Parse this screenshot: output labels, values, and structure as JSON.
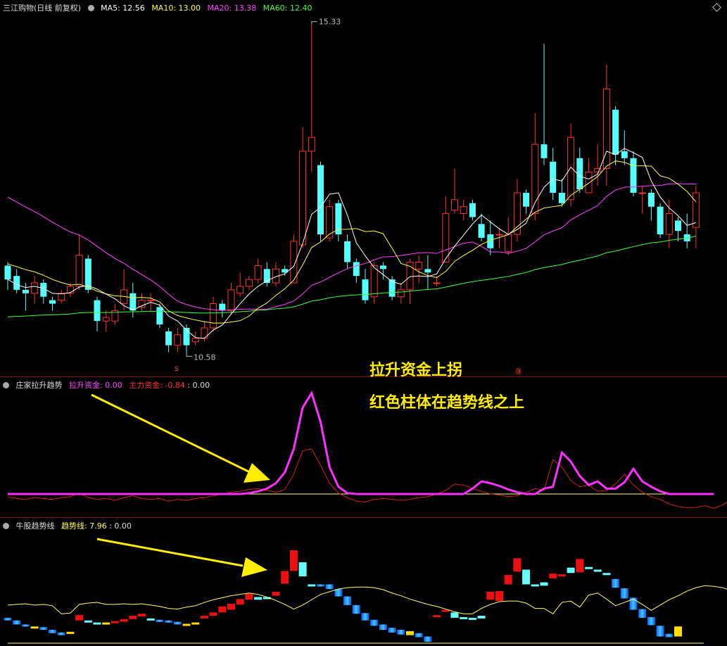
{
  "main": {
    "title": "三江购物(日线 前复权)",
    "ma5": "MA5: 12.56",
    "ma10": "MA10: 13.00",
    "ma20": "MA20: 13.38",
    "ma60": "MA60: 12.40",
    "high_label": "15.33",
    "low_label": "10.58",
    "low_marker": "S",
    "rise_marker": "涨"
  },
  "annotations": {
    "line1": "拉升资金上拐",
    "line2": "红色柱体在趋势线之上"
  },
  "ind1": {
    "name": "庄家拉升趋势",
    "s1": "拉升资金: 0.00",
    "s2": "主力资金: -0.84",
    "s3": ": 0.00"
  },
  "ind2": {
    "name": "牛股趋势线",
    "s1": "趋势线: 7.96",
    "s2": ": 0.00"
  },
  "colors": {
    "up": "#ff3030",
    "down": "#54ffff",
    "ma5": "#ffffff",
    "ma10": "#ffff40",
    "ma20": "#ff40ff",
    "ma60": "#40ff40",
    "annotation": "#ffee00"
  },
  "chart_data": [
    {
      "type": "candlestick",
      "ylim": [
        10.3,
        15.5
      ],
      "candles": [
        [
          11.85,
          11.65,
          11.9,
          11.5
        ],
        [
          11.7,
          11.5,
          11.8,
          11.45
        ],
        [
          11.5,
          11.45,
          11.6,
          11.2
        ],
        [
          11.45,
          11.6,
          11.7,
          11.3
        ],
        [
          11.6,
          11.4,
          11.65,
          11.3
        ],
        [
          11.35,
          11.3,
          11.4,
          11.2
        ],
        [
          11.35,
          11.45,
          11.5,
          11.3
        ],
        [
          11.45,
          11.55,
          11.6,
          11.4
        ],
        [
          11.55,
          12.0,
          12.3,
          11.5
        ],
        [
          11.95,
          11.5,
          12.0,
          11.45
        ],
        [
          11.35,
          11.05,
          11.4,
          10.9
        ],
        [
          11.05,
          11.1,
          11.2,
          10.9
        ],
        [
          11.05,
          11.2,
          11.3,
          11.0
        ],
        [
          11.3,
          11.5,
          11.8,
          11.2
        ],
        [
          11.45,
          11.2,
          11.6,
          11.1
        ],
        [
          11.25,
          11.35,
          11.45,
          11.2
        ],
        [
          11.35,
          11.35,
          11.45,
          11.2
        ],
        [
          11.25,
          11.0,
          11.3,
          10.95
        ],
        [
          10.9,
          10.7,
          10.95,
          10.6
        ],
        [
          10.7,
          10.85,
          10.95,
          10.6
        ],
        [
          10.95,
          10.7,
          11.0,
          10.58
        ],
        [
          10.75,
          10.8,
          10.9,
          10.7
        ],
        [
          10.8,
          10.95,
          11.05,
          10.75
        ],
        [
          10.95,
          11.3,
          11.4,
          10.9
        ],
        [
          11.3,
          11.2,
          11.35,
          11.1
        ],
        [
          11.2,
          11.5,
          11.6,
          11.15
        ],
        [
          11.45,
          11.55,
          11.75,
          11.4
        ],
        [
          11.55,
          11.65,
          11.7,
          11.5
        ],
        [
          11.65,
          11.85,
          11.95,
          11.6
        ],
        [
          11.8,
          11.6,
          11.9,
          11.55
        ],
        [
          11.6,
          11.8,
          11.9,
          11.55
        ],
        [
          11.8,
          11.75,
          11.85,
          11.7
        ],
        [
          11.6,
          12.2,
          12.3,
          11.6
        ],
        [
          12.15,
          13.5,
          13.85,
          12.1
        ],
        [
          13.5,
          13.7,
          15.33,
          13.2
        ],
        [
          13.3,
          12.3,
          13.35,
          12.2
        ],
        [
          12.25,
          12.7,
          12.8,
          12.2
        ],
        [
          12.75,
          12.3,
          12.8,
          12.2
        ],
        [
          12.2,
          11.9,
          12.3,
          11.8
        ],
        [
          11.9,
          11.7,
          11.95,
          11.6
        ],
        [
          11.65,
          11.35,
          11.8,
          11.3
        ],
        [
          11.4,
          11.85,
          11.9,
          11.3
        ],
        [
          11.85,
          11.8,
          11.9,
          11.65
        ],
        [
          11.65,
          11.4,
          11.7,
          11.35
        ],
        [
          11.4,
          11.5,
          11.6,
          11.3
        ],
        [
          11.5,
          11.9,
          11.95,
          11.3
        ],
        [
          11.8,
          11.9,
          12.0,
          11.6
        ],
        [
          11.8,
          11.75,
          12.0,
          11.5
        ],
        [
          11.6,
          11.6,
          11.7,
          11.55
        ],
        [
          11.9,
          12.6,
          12.85,
          11.9
        ],
        [
          12.65,
          12.8,
          13.25,
          12.6
        ],
        [
          12.6,
          12.7,
          12.8,
          12.5
        ],
        [
          12.75,
          12.55,
          12.8,
          12.5
        ],
        [
          12.45,
          12.25,
          12.6,
          12.2
        ],
        [
          12.3,
          12.1,
          12.5,
          12.0
        ],
        [
          12.3,
          12.3,
          12.4,
          12.1
        ],
        [
          12.05,
          12.3,
          12.55,
          12.0
        ],
        [
          12.3,
          12.9,
          13.1,
          12.2
        ],
        [
          12.9,
          12.7,
          12.95,
          12.6
        ],
        [
          12.6,
          13.6,
          14.05,
          12.5
        ],
        [
          13.6,
          13.4,
          15.05,
          13.3
        ],
        [
          13.35,
          12.9,
          13.55,
          12.8
        ],
        [
          12.9,
          12.75,
          13.1,
          12.7
        ],
        [
          12.8,
          13.7,
          13.9,
          12.7
        ],
        [
          13.4,
          12.95,
          13.55,
          12.9
        ],
        [
          12.9,
          13.2,
          13.4,
          12.9
        ],
        [
          13.2,
          13.25,
          13.6,
          13.0
        ],
        [
          13.25,
          14.4,
          14.75,
          13.0
        ],
        [
          14.1,
          13.45,
          14.15,
          13.3
        ],
        [
          13.5,
          13.4,
          13.8,
          13.3
        ],
        [
          13.4,
          12.9,
          13.5,
          12.85
        ],
        [
          12.9,
          12.9,
          13.0,
          12.6
        ],
        [
          12.9,
          12.7,
          12.95,
          12.5
        ],
        [
          12.7,
          12.3,
          12.75,
          12.25
        ],
        [
          12.3,
          12.6,
          12.8,
          12.1
        ],
        [
          12.5,
          12.35,
          12.55,
          12.2
        ],
        [
          12.3,
          12.2,
          12.6,
          12.1
        ],
        [
          12.4,
          12.9,
          13.0,
          12.1
        ]
      ],
      "ma_lines": [
        "MA5",
        "MA10",
        "MA20",
        "MA60"
      ]
    },
    {
      "type": "line",
      "series": [
        {
          "name": "拉升资金",
          "values": [
            0,
            0,
            0,
            0,
            0,
            0,
            0,
            0,
            0,
            0,
            0,
            0,
            0,
            0,
            0,
            0,
            0,
            0,
            0,
            0,
            0,
            0,
            0,
            0,
            0,
            0,
            0,
            0.1,
            0.3,
            0.6,
            1.2,
            2.4,
            5,
            9.6,
            11.2,
            8,
            3,
            0.8,
            0.1,
            0,
            0,
            0,
            0,
            0,
            0,
            0,
            0,
            0,
            0,
            0,
            0,
            0,
            0.6,
            1.4,
            1.2,
            0.9,
            0.5,
            0.2,
            0,
            0,
            0.6,
            0.8,
            4.6,
            3.6,
            2,
            1,
            1.4,
            0.6,
            0.6,
            1.3,
            2.8,
            1.4,
            0.8,
            0.3,
            0,
            0,
            0,
            0,
            0,
            0
          ]
        },
        {
          "name": "主力资金",
          "values": [
            -0.3,
            -0.5,
            -0.6,
            -0.4,
            -0.5,
            -0.6,
            -0.4,
            -0.3,
            0.1,
            -0.4,
            -0.6,
            -0.5,
            -0.7,
            -0.4,
            -0.2,
            -0.5,
            -0.6,
            -0.5,
            -0.8,
            -0.6,
            -0.7,
            -0.5,
            -0.4,
            -0.2,
            0,
            0.2,
            0.3,
            0.5,
            0.6,
            0.4,
            0.2,
            0.5,
            2.2,
            4.8,
            5,
            3.2,
            1.2,
            0.1,
            -0.4,
            -0.8,
            -0.9,
            -0.6,
            -0.5,
            -0.6,
            -0.7,
            -0.6,
            -0.4,
            -0.3,
            0,
            0.4,
            1.1,
            1,
            0.6,
            0.3,
            0,
            -0.1,
            -0.3,
            -0.2,
            0.2,
            0.6,
            0.4,
            3.8,
            3,
            1.5,
            0.8,
            1,
            0.3,
            0.4,
            1.1,
            2.2,
            1,
            0.2,
            -0.3,
            -0.6,
            -1.1,
            -1.4,
            -1.5,
            -1.5,
            -1.3,
            -1.6,
            -1.2,
            -0.6
          ]
        }
      ]
    },
    {
      "type": "bar",
      "trend_line": [
        3.5,
        3.6,
        3.7,
        3.5,
        3.6,
        3.4,
        2.2,
        2.3,
        3.6,
        3.8,
        3.9,
        3.6,
        3.6,
        3.7,
        3.6,
        3.7,
        3.5,
        3.3,
        3,
        2.9,
        3.2,
        3.4,
        3.9,
        4.3,
        4.6,
        4.9,
        5.1,
        5.3,
        5.1,
        4.7,
        4.2,
        3.6,
        2.9,
        3.5,
        4.3,
        5.1,
        5.5,
        5.9,
        6.1,
        6.2,
        6.2,
        6.1,
        5.8,
        5.3,
        4.9,
        4.4,
        4,
        3.6,
        3.3,
        2.9,
        2.5,
        2.2,
        2.2,
        3,
        3.6,
        4,
        4.1,
        4.1,
        3.8,
        3,
        3,
        2.2,
        3.9,
        4.1,
        3.2,
        5,
        5.3,
        4.4,
        3.4,
        3.9,
        4.4,
        3.6,
        2.7,
        3.5,
        4.3,
        4.9,
        5.6,
        6.1,
        6.4,
        6.3,
        6.1,
        5.6,
        5.1,
        4.7,
        4.3,
        3.8
      ],
      "bars": [
        [
          1.2,
          1.6,
          "d"
        ],
        [
          1.2,
          0.6,
          "d"
        ],
        [
          0.6,
          0.3,
          "d"
        ],
        [
          0.3,
          0.2,
          "y"
        ],
        [
          0.2,
          -0.2,
          "d"
        ],
        [
          -0.2,
          -0.7,
          "d"
        ],
        [
          -0.6,
          -1.0,
          "d"
        ],
        [
          -0.8,
          -0.5,
          "y"
        ],
        [
          1.2,
          2.0,
          "r"
        ],
        [
          1.2,
          1.0,
          "c"
        ],
        [
          0.9,
          0.9,
          "c"
        ],
        [
          0.9,
          0.9,
          "y"
        ],
        [
          0.9,
          1.1,
          "r"
        ],
        [
          1.0,
          1.4,
          "r"
        ],
        [
          1.4,
          1.9,
          "r"
        ],
        [
          1.8,
          2.2,
          "r"
        ],
        [
          1.5,
          1.3,
          "c"
        ],
        [
          1.3,
          1.2,
          "d"
        ],
        [
          1.2,
          1.0,
          "d"
        ],
        [
          1.0,
          0.6,
          "d"
        ],
        [
          0.5,
          0.7,
          "y"
        ],
        [
          0.7,
          0.9,
          "y"
        ],
        [
          1.9,
          1.5,
          "r"
        ],
        [
          1.9,
          2.4,
          "r"
        ],
        [
          3.3,
          2.4,
          "r"
        ],
        [
          2.8,
          3.7,
          "r"
        ],
        [
          3.6,
          4.4,
          "r"
        ],
        [
          4.3,
          5.2,
          "r"
        ],
        [
          4.3,
          4.7,
          "c"
        ],
        [
          4.4,
          4.7,
          "c"
        ],
        [
          4.9,
          5.5,
          "r"
        ],
        [
          6.7,
          8.6,
          "r"
        ],
        [
          8.6,
          11.7,
          "r"
        ],
        [
          9.9,
          7.8,
          "c"
        ],
        [
          6.6,
          6.6,
          "c"
        ],
        [
          6.6,
          6.6,
          "d"
        ],
        [
          6.6,
          5.9,
          "d"
        ],
        [
          5.9,
          4.8,
          "d"
        ],
        [
          4.8,
          3.5,
          "d"
        ],
        [
          3.5,
          2.2,
          "d"
        ],
        [
          2.3,
          1.2,
          "d"
        ],
        [
          1.3,
          0.4,
          "d"
        ],
        [
          0.6,
          -0.2,
          "d"
        ],
        [
          0.1,
          -0.6,
          "d"
        ],
        [
          -0.2,
          -0.9,
          "d"
        ],
        [
          -0.4,
          -1.0,
          "y"
        ],
        [
          -0.7,
          -1.3,
          "d"
        ],
        [
          -1.2,
          -2.0,
          "d"
        ],
        [
          2.0,
          1.9,
          "r"
        ],
        [
          2.6,
          2.8,
          "r"
        ],
        [
          2.4,
          1.6,
          "c"
        ],
        [
          1.7,
          1.6,
          "c"
        ],
        [
          1.6,
          1.6,
          "c"
        ],
        [
          1.9,
          1.5,
          "c"
        ],
        [
          4.3,
          5.5,
          "r"
        ],
        [
          4.1,
          5.6,
          "r"
        ],
        [
          6.6,
          8.0,
          "r"
        ],
        [
          8.5,
          10.5,
          "r"
        ],
        [
          6.6,
          8.8,
          "c"
        ],
        [
          6.5,
          6.6,
          "c"
        ],
        [
          6.4,
          6.9,
          "c"
        ],
        [
          7.5,
          8.2,
          "r"
        ],
        [
          8.0,
          8.1,
          "r"
        ],
        [
          9.1,
          8.3,
          "c"
        ],
        [
          8.4,
          10.4,
          "r"
        ],
        [
          9.2,
          9.2,
          "c"
        ],
        [
          8.8,
          8.8,
          "c"
        ],
        [
          8.3,
          8.3,
          "c"
        ],
        [
          7.4,
          6.1,
          "d"
        ],
        [
          6.0,
          4.5,
          "d"
        ],
        [
          4.6,
          2.8,
          "d"
        ],
        [
          2.9,
          1.6,
          "d"
        ],
        [
          1.7,
          0.5,
          "d"
        ],
        [
          0.4,
          -1.2,
          "d"
        ],
        [
          -0.8,
          -1.3,
          "d"
        ],
        [
          -1.2,
          0.3,
          "y"
        ]
      ]
    }
  ]
}
